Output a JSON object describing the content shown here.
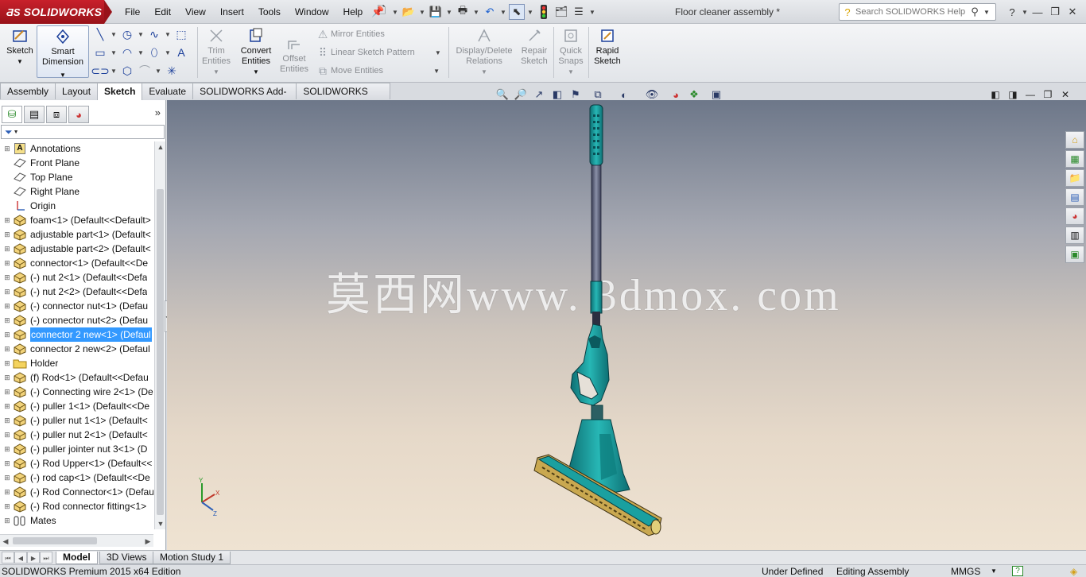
{
  "app": {
    "brand": "SOLIDWORKS",
    "document_title": "Floor cleaner assembly *"
  },
  "menu": [
    "File",
    "Edit",
    "View",
    "Insert",
    "Tools",
    "Window",
    "Help"
  ],
  "search": {
    "placeholder": "Search SOLIDWORKS Help"
  },
  "command_manager": {
    "sketch": "Sketch",
    "smart_dimension": [
      "Smart",
      "Dimension"
    ],
    "trim_entities": [
      "Trim",
      "Entities"
    ],
    "convert_entities": [
      "Convert",
      "Entities"
    ],
    "offset_entities": [
      "Offset",
      "Entities"
    ],
    "mirror_entities": "Mirror Entities",
    "linear_sketch_pattern": "Linear Sketch Pattern",
    "move_entities": "Move Entities",
    "display_delete_relations": [
      "Display/Delete",
      "Relations"
    ],
    "repair_sketch": [
      "Repair",
      "Sketch"
    ],
    "quick_snaps": [
      "Quick",
      "Snaps"
    ],
    "rapid_sketch": [
      "Rapid",
      "Sketch"
    ]
  },
  "command_tabs": [
    "Assembly",
    "Layout",
    "Sketch",
    "Evaluate",
    "SOLIDWORKS Add-Ins",
    "SOLIDWORKS MBD"
  ],
  "active_command_tab": "Sketch",
  "feature_tree": [
    {
      "label": "Annotations",
      "icon": "annotations-icon",
      "expandable": true
    },
    {
      "label": "Front Plane",
      "icon": "plane-icon",
      "expandable": false
    },
    {
      "label": "Top Plane",
      "icon": "plane-icon",
      "expandable": false
    },
    {
      "label": "Right Plane",
      "icon": "plane-icon",
      "expandable": false
    },
    {
      "label": "Origin",
      "icon": "origin-icon",
      "expandable": false
    },
    {
      "label": "foam<1> (Default<<Default>",
      "icon": "part-icon",
      "expandable": true
    },
    {
      "label": "adjustable part<1> (Default<",
      "icon": "part-icon",
      "expandable": true
    },
    {
      "label": "adjustable part<2> (Default<",
      "icon": "part-icon",
      "expandable": true
    },
    {
      "label": "connector<1> (Default<<De",
      "icon": "part-icon",
      "expandable": true
    },
    {
      "label": "(-) nut 2<1> (Default<<Defa",
      "icon": "part-icon",
      "expandable": true
    },
    {
      "label": "(-) nut 2<2> (Default<<Defa",
      "icon": "part-icon",
      "expandable": true
    },
    {
      "label": "(-) connector nut<1> (Defau",
      "icon": "part-icon",
      "expandable": true
    },
    {
      "label": "(-) connector nut<2> (Defau",
      "icon": "part-icon",
      "expandable": true
    },
    {
      "label": "connector 2 new<1> (Defaul",
      "icon": "part-icon",
      "expandable": true,
      "selected": true
    },
    {
      "label": "connector 2 new<2> (Defaul",
      "icon": "part-icon",
      "expandable": true
    },
    {
      "label": "Holder",
      "icon": "folder-icon",
      "expandable": true
    },
    {
      "label": "(f) Rod<1> (Default<<Defau",
      "icon": "part-icon",
      "expandable": true
    },
    {
      "label": "(-) Connecting wire 2<1> (De",
      "icon": "part-icon",
      "expandable": true
    },
    {
      "label": "(-) puller 1<1> (Default<<De",
      "icon": "part-icon",
      "expandable": true
    },
    {
      "label": "(-) puller nut 1<1> (Default<",
      "icon": "part-icon",
      "expandable": true
    },
    {
      "label": "(-) puller nut 2<1> (Default<",
      "icon": "part-icon",
      "expandable": true
    },
    {
      "label": "(-) puller jointer nut 3<1> (D",
      "icon": "part-icon",
      "expandable": true
    },
    {
      "label": "(-) Rod Upper<1> (Default<<",
      "icon": "part-icon",
      "expandable": true
    },
    {
      "label": "(-) rod cap<1> (Default<<De",
      "icon": "part-icon",
      "expandable": true
    },
    {
      "label": "(-) Rod Connector<1> (Defau",
      "icon": "part-icon",
      "expandable": true
    },
    {
      "label": "(-) Rod connector fitting<1>",
      "icon": "part-icon",
      "expandable": true
    },
    {
      "label": "Mates",
      "icon": "mates-icon",
      "expandable": true
    }
  ],
  "viewport": {
    "watermark": "莫西网www. 3dmox. com",
    "triad_labels": {
      "x": "X",
      "y": "Y",
      "z": "Z"
    },
    "model_color": "#1fa6a6"
  },
  "bottom_tabs": [
    "Model",
    "3D Views",
    "Motion Study 1"
  ],
  "active_bottom_tab": "Model",
  "status": {
    "edition": "SOLIDWORKS Premium 2015 x64 Edition",
    "sketch_state": "Under Defined",
    "mode": "Editing Assembly",
    "units": "MMGS"
  },
  "colors": {
    "brand_red": "#c8202b",
    "selection": "#3399ff",
    "model_teal": "#1fa6a6"
  }
}
